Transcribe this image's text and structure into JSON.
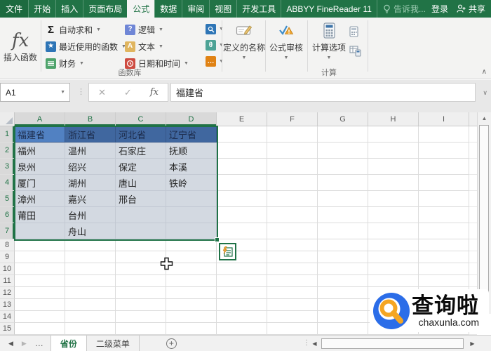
{
  "colors": {
    "excel_green": "#217346",
    "header_row_fill": "#4472c4",
    "header_row_fill_shaded": "#40679f",
    "selection_fill": "#d3d9e1",
    "selection_border": "#1f7246",
    "watermark_blue": "#2b6de8",
    "watermark_orange": "#f5a623"
  },
  "titlebar": {
    "file_label": "文件",
    "tabs": [
      {
        "label": "开始",
        "active": false
      },
      {
        "label": "插入",
        "active": false
      },
      {
        "label": "页面布局",
        "active": false
      },
      {
        "label": "公式",
        "active": true
      },
      {
        "label": "数据",
        "active": false
      },
      {
        "label": "审阅",
        "active": false
      },
      {
        "label": "视图",
        "active": false
      },
      {
        "label": "开发工具",
        "active": false
      },
      {
        "label": "ABBYY FineReader 11",
        "active": false
      }
    ],
    "tell_me": "告诉我...",
    "sign_in": "登录",
    "share": "共享"
  },
  "ribbon": {
    "fx_glyph": "fx",
    "insert_function_label": "插入函数",
    "function_buttons": [
      {
        "label": "自动求和",
        "glyph": "Σ"
      },
      {
        "label": "最近使用的函数",
        "glyph": "★"
      },
      {
        "label": "财务",
        "glyph": ""
      },
      {
        "label": "逻辑",
        "glyph": "?"
      },
      {
        "label": "文本",
        "glyph": "A"
      },
      {
        "label": "日期和时间",
        "glyph": ""
      }
    ],
    "small_function_icons": [
      "lookup-reference-icon",
      "math-trig-icon",
      "more-functions-icon"
    ],
    "math_trig_glyph": "θ",
    "more_functions_glyph": "…",
    "group_function_library": "函数库",
    "defined_names_label": "定义的名称",
    "formula_auditing_label": "公式审核",
    "calc_options_label": "计算选项",
    "group_calculation": "计算"
  },
  "formula_bar": {
    "name_box": "A1",
    "cancel_glyph": "✕",
    "enter_glyph": "✓",
    "fx_glyph": "fx",
    "value": "福建省"
  },
  "sheet": {
    "columns": [
      "A",
      "B",
      "C",
      "D",
      "E",
      "F",
      "G",
      "H",
      "I"
    ],
    "selected_columns": [
      "A",
      "B",
      "C",
      "D"
    ],
    "selected_row_count": 7,
    "visible_row_count": 15,
    "header_row": [
      "福建省",
      "浙江省",
      "河北省",
      "辽宁省"
    ],
    "data_rows": [
      [
        "福州",
        "温州",
        "石家庄",
        "抚顺"
      ],
      [
        "泉州",
        "绍兴",
        "保定",
        "本溪"
      ],
      [
        "厦门",
        "湖州",
        "唐山",
        "铁岭"
      ],
      [
        "漳州",
        "嘉兴",
        "邢台",
        ""
      ],
      [
        "莆田",
        "台州",
        "",
        ""
      ],
      [
        "",
        "舟山",
        "",
        ""
      ]
    ]
  },
  "sheet_tabs": {
    "tabs": [
      {
        "label": "省份",
        "active": true
      },
      {
        "label": "二级菜单",
        "active": false
      }
    ]
  },
  "watermark": {
    "title": "查询啦",
    "domain": "chaxunla.com"
  }
}
